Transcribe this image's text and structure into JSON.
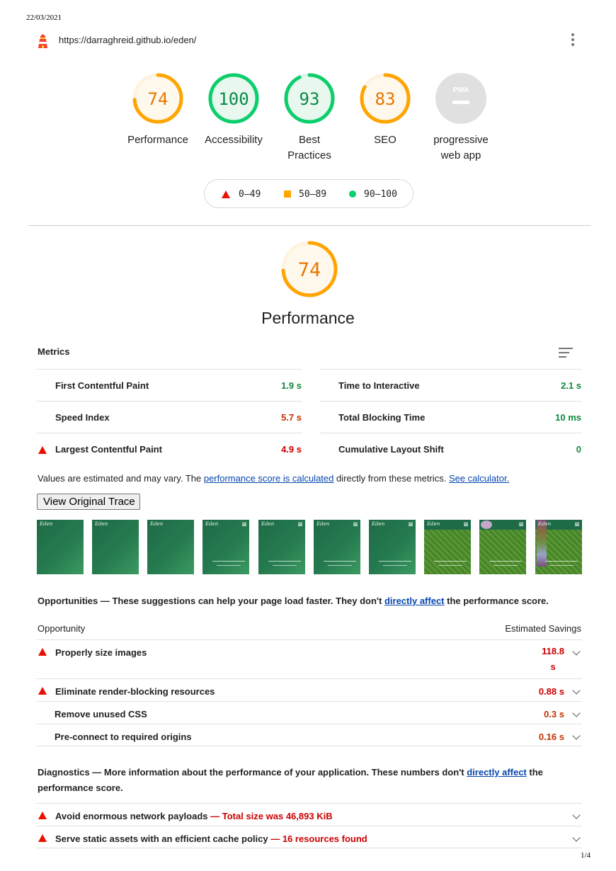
{
  "print_date": "22/03/2021",
  "page_number": "1/4",
  "url": "https://darraghreid.github.io/eden/",
  "colors": {
    "pass": "#0cce6b",
    "average": "#ffa400",
    "fail": "#ff4e42",
    "na": "#cccccc"
  },
  "gauges": [
    {
      "score": "74",
      "value": 74,
      "label": "Performance",
      "rating": "average"
    },
    {
      "score": "100",
      "value": 100,
      "label": "Accessibility",
      "rating": "pass"
    },
    {
      "score": "93",
      "value": 93,
      "label": "Best Practices",
      "rating": "pass"
    },
    {
      "score": "83",
      "value": 83,
      "label": "SEO",
      "rating": "average"
    },
    {
      "score": "",
      "value": 0,
      "label": "progressive web app",
      "rating": "na",
      "badge": "PWA"
    }
  ],
  "legend": {
    "fail": "0–49",
    "average": "50–89",
    "pass": "90–100"
  },
  "performance": {
    "score": "74",
    "value": 74,
    "title": "Performance"
  },
  "metrics": {
    "heading": "Metrics",
    "left": [
      {
        "label": "First Contentful Paint",
        "value": "1.9 s",
        "rating": "good"
      },
      {
        "label": "Speed Index",
        "value": "5.7 s",
        "rating": "avg"
      },
      {
        "label": "Largest Contentful Paint",
        "value": "4.9 s",
        "rating": "fail"
      }
    ],
    "right": [
      {
        "label": "Time to Interactive",
        "value": "2.1 s",
        "rating": "good"
      },
      {
        "label": "Total Blocking Time",
        "value": "10 ms",
        "rating": "good"
      },
      {
        "label": "Cumulative Layout Shift",
        "value": "0",
        "rating": "good"
      }
    ]
  },
  "estimate_note": {
    "text1": "Values are estimated and may vary. The ",
    "link1": "performance score is calculated",
    "text2": " directly from these metrics.",
    "link2": "See calculator."
  },
  "trace_button": "View Original Trace",
  "filmstrip_logo": "Eden",
  "opportunities": {
    "heading": "Opportunities",
    "dash": " — ",
    "desc1": "These suggestions can help your page load faster. They don't ",
    "link": "directly affect",
    "desc2": " the performance score.",
    "col_left": "Opportunity",
    "col_right": "Estimated Savings",
    "rows": [
      {
        "label": "Properly size images",
        "value_line1": "118.8",
        "value_line2": "s",
        "rating": "fail"
      },
      {
        "label": "Eliminate render-blocking resources",
        "value": "0.88 s",
        "rating": "fail"
      },
      {
        "label": "Remove unused CSS",
        "value": "0.3 s",
        "rating": "avg"
      },
      {
        "label": "Pre-connect to required origins",
        "value": "0.16 s",
        "rating": "avg"
      }
    ]
  },
  "diagnostics": {
    "heading": "Diagnostics",
    "dash": " — ",
    "desc1": "More information about the performance of your application. These numbers don't ",
    "link": "directly affect",
    "desc2": " the performance score.",
    "rows": [
      {
        "label": "Avoid enormous network payloads",
        "extra": "Total size was 46,893 KiB"
      },
      {
        "label": "Serve static assets with an efficient cache policy",
        "extra": "16 resources found"
      }
    ]
  }
}
